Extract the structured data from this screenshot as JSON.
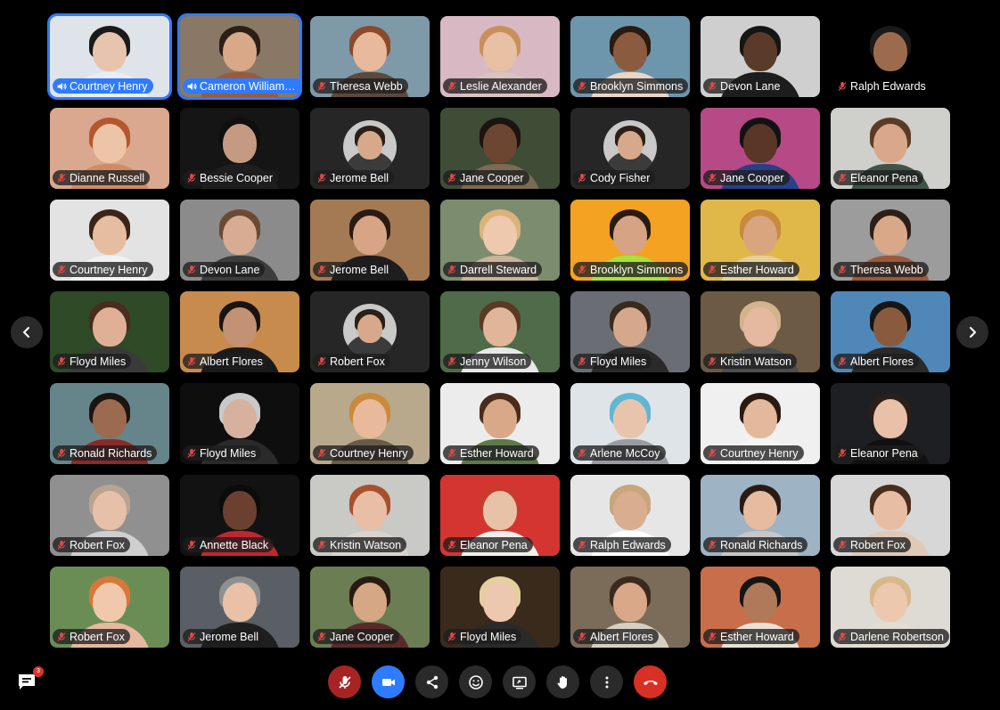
{
  "participants": [
    {
      "name": "Courtney Henry",
      "speaking": true,
      "bg": "#dfe3ea",
      "skin": "#e6c4ad",
      "hair": "#1a1a1a",
      "shirt": "#e9edf5"
    },
    {
      "name": "Cameron Williamson",
      "speaking": true,
      "bg": "#8a7866",
      "skin": "#d9a888",
      "hair": "#2b1f17",
      "shirt": "#9a5a3c"
    },
    {
      "name": "Theresa Webb",
      "speaking": false,
      "bg": "#7e99a8",
      "skin": "#e9b99c",
      "hair": "#8b4a2b",
      "shirt": "#5a4a3e"
    },
    {
      "name": "Leslie Alexander",
      "speaking": false,
      "bg": "#d7b8c3",
      "skin": "#e8c0a3",
      "hair": "#c98f5a",
      "shirt": "#d9c4bd"
    },
    {
      "name": "Brooklyn Simmons",
      "speaking": false,
      "bg": "#6d96ad",
      "skin": "#8a5b3e",
      "hair": "#2a1a10",
      "shirt": "#e8d6c6"
    },
    {
      "name": "Devon Lane",
      "speaking": false,
      "bg": "#cfcfcf",
      "skin": "#5a3a28",
      "hair": "#151515",
      "shirt": "#1d1d1d"
    },
    {
      "name": "Ralph Edwards",
      "speaking": false,
      "bare": true,
      "bg": "#000000",
      "skin": "#9c6b4d",
      "hair": "#1a1a1a",
      "shirt": "#000000"
    },
    {
      "name": "Dianne Russell",
      "speaking": false,
      "bg": "#d9a88e",
      "skin": "#ecc4a8",
      "hair": "#b5562e",
      "shirt": "#d08b66"
    },
    {
      "name": "Bessie Cooper",
      "speaking": false,
      "bg": "#151515",
      "skin": "#c49a82",
      "hair": "#0f0f0f",
      "shirt": "#1e1e1e"
    },
    {
      "name": "Jerome Bell",
      "speaking": false,
      "avatar": true,
      "bg": "#262626",
      "skin": "#d7a98a",
      "hair": "#2b1f17",
      "shirt": "#3b3b3b"
    },
    {
      "name": "Jane Cooper",
      "speaking": false,
      "bg": "#3f4c36",
      "skin": "#6d4632",
      "hair": "#1b1410",
      "shirt": "#7d6a52"
    },
    {
      "name": "Cody Fisher",
      "speaking": false,
      "avatar": true,
      "bg": "#262626",
      "skin": "#d7a98a",
      "hair": "#2b1f17",
      "shirt": "#3b3b3b"
    },
    {
      "name": "Jane Cooper",
      "speaking": false,
      "bg": "#b54a86",
      "skin": "#5a3626",
      "hair": "#121212",
      "shirt": "#2a3f86"
    },
    {
      "name": "Eleanor Pena",
      "speaking": false,
      "bg": "#cfcfcb",
      "skin": "#d9a88a",
      "hair": "#5b3b25",
      "shirt": "#3f5446"
    },
    {
      "name": "Courtney Henry",
      "speaking": false,
      "bg": "#e3e3e3",
      "skin": "#e7bda1",
      "hair": "#3a2518",
      "shirt": "#f2f2f2"
    },
    {
      "name": "Devon Lane",
      "speaking": false,
      "bg": "#8b8b8b",
      "skin": "#d7ac92",
      "hair": "#6b4a33",
      "shirt": "#3d3d3d"
    },
    {
      "name": "Jerome Bell",
      "speaking": false,
      "bg": "#a47a55",
      "skin": "#d7a585",
      "hair": "#2a1b12",
      "shirt": "#1e1e1e"
    },
    {
      "name": "Darrell Steward",
      "speaking": false,
      "bg": "#7c8c6f",
      "skin": "#efc9ad",
      "hair": "#d9b37a",
      "shirt": "#c9b39a"
    },
    {
      "name": "Brooklyn Simmons",
      "speaking": false,
      "bg": "#f3a222",
      "skin": "#d6a385",
      "hair": "#2a1b12",
      "shirt": "#a8e23a"
    },
    {
      "name": "Esther Howard",
      "speaking": false,
      "bg": "#e0b84a",
      "skin": "#d9a57f",
      "hair": "#c98a3d",
      "shirt": "#e4d19a"
    },
    {
      "name": "Theresa Webb",
      "speaking": false,
      "bg": "#9c9c9c",
      "skin": "#d9a888",
      "hair": "#2b1f17",
      "shirt": "#9a5a3c"
    },
    {
      "name": "Floyd Miles",
      "speaking": false,
      "bg": "#2f4a27",
      "skin": "#e0b096",
      "hair": "#4a2c1c",
      "shirt": "#3a3a3a"
    },
    {
      "name": "Albert Flores",
      "speaking": false,
      "bg": "#c78b4e",
      "skin": "#c39274",
      "hair": "#1a1410",
      "shirt": "#1a1a1a"
    },
    {
      "name": "Robert Fox",
      "speaking": false,
      "avatar": true,
      "bg": "#262626",
      "skin": "#d7a98a",
      "hair": "#2b1f17",
      "shirt": "#3b3b3b"
    },
    {
      "name": "Jenny Wilson",
      "speaking": false,
      "bg": "#4f6b4a",
      "skin": "#e0b59a",
      "hair": "#5a3a22",
      "shirt": "#e8e8e8"
    },
    {
      "name": "Floyd Miles",
      "speaking": false,
      "bg": "#6a6e74",
      "skin": "#d6a88b",
      "hair": "#3a2a1e",
      "shirt": "#2a2a2a"
    },
    {
      "name": "Kristin Watson",
      "speaking": false,
      "bg": "#6d5a45",
      "skin": "#e4b9a0",
      "hair": "#d2b48c",
      "shirt": "#4d4d4d"
    },
    {
      "name": "Albert Flores",
      "speaking": false,
      "bg": "#4f87b8",
      "skin": "#8a5a3e",
      "hair": "#151515",
      "shirt": "#2a2a2a"
    },
    {
      "name": "Ronald Richards",
      "speaking": false,
      "bg": "#66858a",
      "skin": "#9c6a4e",
      "hair": "#1b1410",
      "shirt": "#8a2a2a"
    },
    {
      "name": "Floyd Miles",
      "speaking": false,
      "bg": "#0e0e0e",
      "skin": "#d6b29e",
      "hair": "#c9c9c9",
      "shirt": "#2a2a2a"
    },
    {
      "name": "Courtney Henry",
      "speaking": false,
      "bg": "#b9a98c",
      "skin": "#e8b99a",
      "hair": "#c98a3d",
      "shirt": "#6a5a4a"
    },
    {
      "name": "Esther Howard",
      "speaking": false,
      "bg": "#ececec",
      "skin": "#d9a888",
      "hair": "#4a2c1c",
      "shirt": "#5e7a4a"
    },
    {
      "name": "Arlene McCoy",
      "speaking": false,
      "bg": "#dfe4e8",
      "skin": "#e9c4ad",
      "hair": "#5fb7d4",
      "shirt": "#9b9ca1"
    },
    {
      "name": "Courtney Henry",
      "speaking": false,
      "bg": "#f0f0f0",
      "skin": "#e3b89c",
      "hair": "#2a1b12",
      "shirt": "#f5f5f5"
    },
    {
      "name": "Eleanor Pena",
      "speaking": false,
      "bg": "#1d1f22",
      "skin": "#e8c1a8",
      "hair": "#2b1f17",
      "shirt": "#101010"
    },
    {
      "name": "Robert Fox",
      "speaking": false,
      "bg": "#909090",
      "skin": "#e6c0a8",
      "hair": "#b8a48f",
      "shirt": "#cfcfcf"
    },
    {
      "name": "Annette Black",
      "speaking": false,
      "bg": "#121212",
      "skin": "#6b4030",
      "hair": "#0b0b0b",
      "shirt": "#c0272d"
    },
    {
      "name": "Kristin Watson",
      "speaking": false,
      "bg": "#c9c9c6",
      "skin": "#e8bfa5",
      "hair": "#a8502c",
      "shirt": "#d8d5cf"
    },
    {
      "name": "Eleanor Pena",
      "speaking": false,
      "bg": "#d43531",
      "skin": "#e8c2a6",
      "hair": "#c93b2c",
      "shirt": "#f0efe9"
    },
    {
      "name": "Ralph Edwards",
      "speaking": false,
      "bg": "#e6e6e6",
      "skin": "#d9ad8f",
      "hair": "#c8a57a",
      "shirt": "#ffffff"
    },
    {
      "name": "Ronald Richards",
      "speaking": false,
      "bg": "#9eb3c4",
      "skin": "#e6bb9f",
      "hair": "#2a1b12",
      "shirt": "#c7c7c7"
    },
    {
      "name": "Robert Fox",
      "speaking": false,
      "bg": "#d7d7d7",
      "skin": "#e7bea3",
      "hair": "#4a2c1c",
      "shirt": "#e0c9b6"
    },
    {
      "name": "Robert Fox",
      "speaking": false,
      "bg": "#6a8d55",
      "skin": "#f0c8ac",
      "hair": "#d9773a",
      "shirt": "#e6b89e"
    },
    {
      "name": "Jerome Bell",
      "speaking": false,
      "bg": "#5a5f66",
      "skin": "#e8c1a6",
      "hair": "#8f8f8f",
      "shirt": "#1f1f1f"
    },
    {
      "name": "Jane Cooper",
      "speaking": false,
      "bg": "#6b7d52",
      "skin": "#d6a785",
      "hair": "#2a1b12",
      "shirt": "#5a2a2a"
    },
    {
      "name": "Floyd Miles",
      "speaking": false,
      "bg": "#3a2a1c",
      "skin": "#ecc8b0",
      "hair": "#e4cfa0",
      "shirt": "#2a2a2a"
    },
    {
      "name": "Albert Flores",
      "speaking": false,
      "bg": "#7b6c5a",
      "skin": "#d9a888",
      "hair": "#3a2a1e",
      "shirt": "#d7cfc2"
    },
    {
      "name": "Esther Howard",
      "speaking": false,
      "bg": "#c86e4a",
      "skin": "#b07a5a",
      "hair": "#151515",
      "shirt": "#e8e2d6"
    },
    {
      "name": "Darlene Robertson",
      "speaking": false,
      "bg": "#dedad4",
      "skin": "#ecc9ae",
      "hair": "#d7b88a",
      "shirt": "#e3ddd3"
    }
  ],
  "badge_count": "3",
  "colors": {
    "accent": "#2e7bff",
    "danger": "#d93025",
    "mute": "#a72424"
  },
  "toolbar": [
    "mic-off-icon",
    "video-icon",
    "share-icon",
    "emoji-icon",
    "present-icon",
    "raise-hand-icon",
    "more-icon",
    "end-call-icon"
  ]
}
